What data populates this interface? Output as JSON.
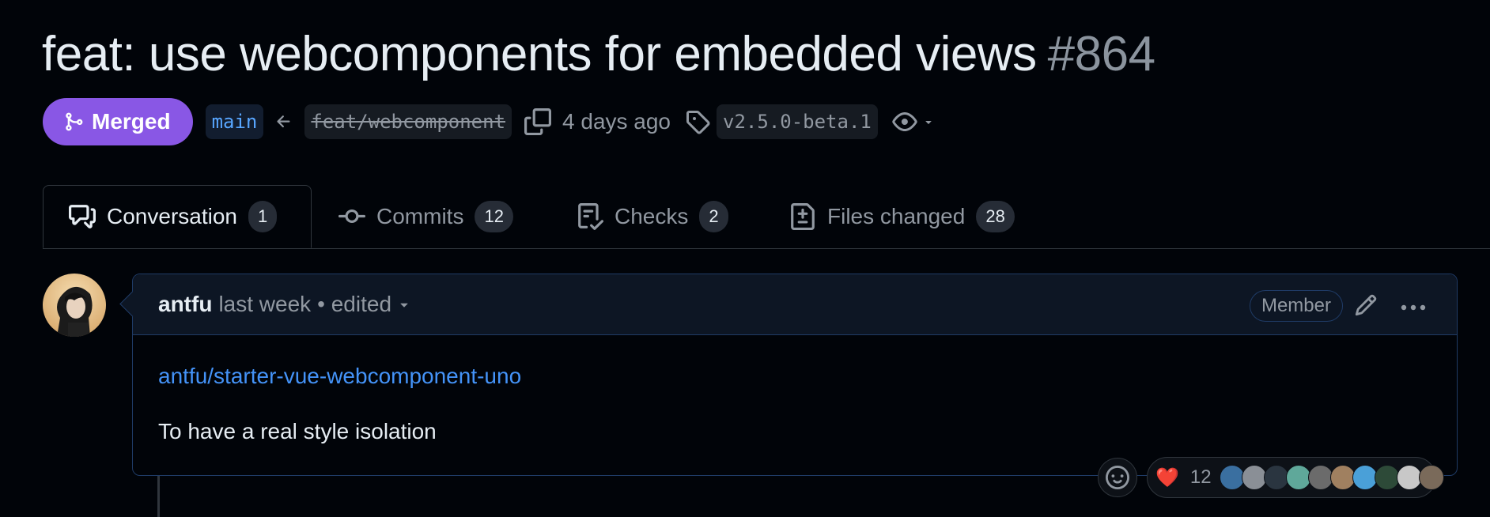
{
  "pr": {
    "title": "feat: use webcomponents for embedded views",
    "number": "#864",
    "state": "Merged",
    "base_branch": "main",
    "head_branch": "feat/webcomponent",
    "time_ago": "4 days ago",
    "tag": "v2.5.0-beta.1"
  },
  "tabs": [
    {
      "label": "Conversation",
      "count": "1",
      "icon": "comment-discussion-icon"
    },
    {
      "label": "Commits",
      "count": "12",
      "icon": "git-commit-icon"
    },
    {
      "label": "Checks",
      "count": "2",
      "icon": "checklist-icon"
    },
    {
      "label": "Files changed",
      "count": "28",
      "icon": "file-diff-icon"
    }
  ],
  "comment": {
    "author": "antfu",
    "when": "last week",
    "edited": "• edited",
    "role": "Member",
    "link": "antfu/starter-vue-webcomponent-uno",
    "body": "To have a real style isolation"
  },
  "reactions": {
    "emoji": "❤️",
    "count": "12"
  },
  "colors": {
    "merged": "#8957e5",
    "link": "#4493f8",
    "background": "#010409",
    "border_accent": "#1f3b66"
  }
}
